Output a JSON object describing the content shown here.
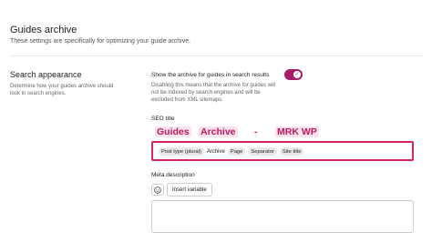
{
  "header": {
    "title": "Guides archive",
    "description": "These settings are specifically for optimizing your guide archive."
  },
  "search_appearance": {
    "title": "Search appearance",
    "description": "Determine how your guides archive should look in search engines."
  },
  "toggle": {
    "label": "Show the archive for guides in search results",
    "description": "Disabling this means that the archive for guides will not be indexed by search engines and will be excluded from XML sitemaps.",
    "state": "on",
    "checkmark": "✓",
    "color": "#a61e69"
  },
  "seo_title": {
    "label": "SEO title",
    "preview": {
      "part1": "Guides",
      "part2": "Archive",
      "separator": "-",
      "site": "MRK WP"
    },
    "chips": {
      "post_type": "Post type (plural)",
      "archive_text": "Archive",
      "page": "Page",
      "separator": "Separator",
      "site_title": "Site title"
    },
    "highlight_color": "#d6245f"
  },
  "meta_description": {
    "label": "Meta description",
    "emoji_icon": "smiley-icon",
    "insert_label": "Insert variable",
    "value": ""
  }
}
